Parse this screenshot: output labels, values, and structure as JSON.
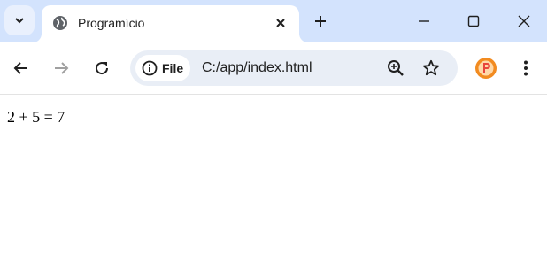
{
  "tab": {
    "title": "Programício",
    "favicon": "globe-icon"
  },
  "window_controls": [
    "minimize-icon",
    "maximize-icon",
    "close-icon"
  ],
  "toolbar": {
    "back": "back-arrow-icon",
    "forward": "forward-arrow-icon",
    "reload": "reload-icon",
    "site_info_label": "File",
    "url": "C:/app/index.html",
    "zoom": "zoom-in-icon",
    "bookmark": "star-icon",
    "profile": "profile-avatar",
    "menu": "kebab-menu-icon"
  },
  "page": {
    "text": "2 + 5 = 7"
  },
  "colors": {
    "titlebar": "#d3e3fd",
    "omnibox": "#e9eef6",
    "profile": "#f28b20"
  }
}
